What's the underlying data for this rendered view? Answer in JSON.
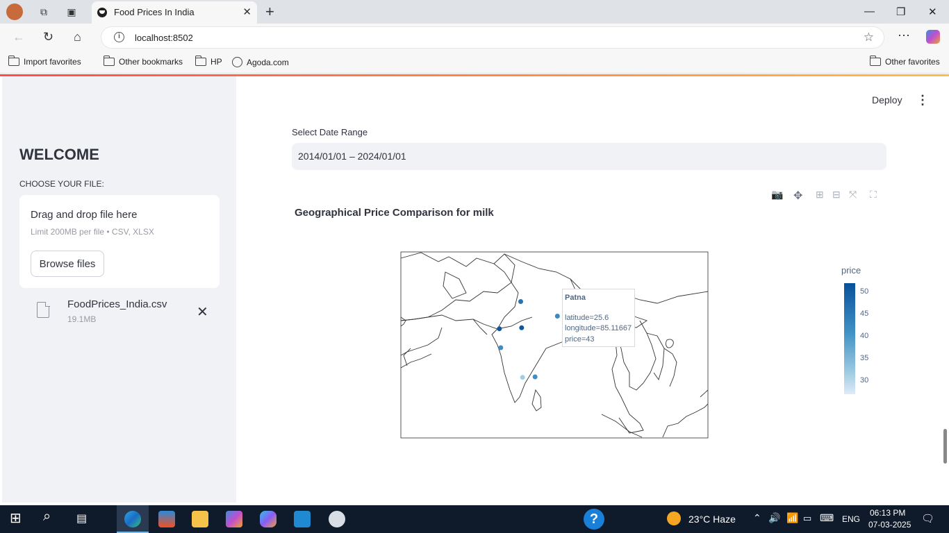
{
  "browser": {
    "tab_title": "Food Prices In India",
    "url": "localhost:8502",
    "bookmarks": [
      "Import favorites",
      "Other bookmarks",
      "HP",
      "Agoda.com"
    ],
    "other_favorites": "Other favorites"
  },
  "sidebar": {
    "welcome": "WELCOME",
    "choose_label": "CHOOSE YOUR FILE:",
    "drop_text": "Drag and drop file here",
    "limit_text": "Limit 200MB per file • CSV, XLSX",
    "browse_label": "Browse files",
    "file_name": "FoodPrices_India.csv",
    "file_size": "19.1MB"
  },
  "header": {
    "deploy_label": "Deploy"
  },
  "date_range": {
    "label": "Select Date Range",
    "value": "2014/01/01 – 2024/01/01"
  },
  "chart": {
    "title": "Geographical Price Comparison for milk",
    "hover": {
      "name": "Patna",
      "lat": "latitude=25.6",
      "lon": "longitude=85.11667",
      "price": "price=43"
    },
    "colorbar_title": "price",
    "colorbar_ticks": [
      "50",
      "45",
      "40",
      "35",
      "30"
    ]
  },
  "chart_data": {
    "type": "scatter",
    "title": "Geographical Price Comparison for milk",
    "color_variable": "price",
    "color_range": [
      27,
      53
    ],
    "points": [
      {
        "name": "Patna",
        "latitude": 25.6,
        "longitude": 85.11667,
        "price": 43
      },
      {
        "latitude": 28.6,
        "longitude": 77.2,
        "price": 47
      },
      {
        "latitude": 23.0,
        "longitude": 72.6,
        "price": 52
      },
      {
        "latitude": 23.2,
        "longitude": 77.4,
        "price": 52
      },
      {
        "latitude": 19.1,
        "longitude": 72.9,
        "price": 42
      },
      {
        "latitude": 13.0,
        "longitude": 77.6,
        "price": 33
      },
      {
        "latitude": 13.1,
        "longitude": 80.3,
        "price": 42
      }
    ]
  },
  "taskbar": {
    "weather": "23°C  Haze",
    "lang": "ENG",
    "time": "06:13 PM",
    "date": "07-03-2025"
  },
  "colors": {
    "accent_start": "#ff4b4b",
    "accent_end": "#ffbd45",
    "sidebar_bg": "#f0f2f6"
  }
}
